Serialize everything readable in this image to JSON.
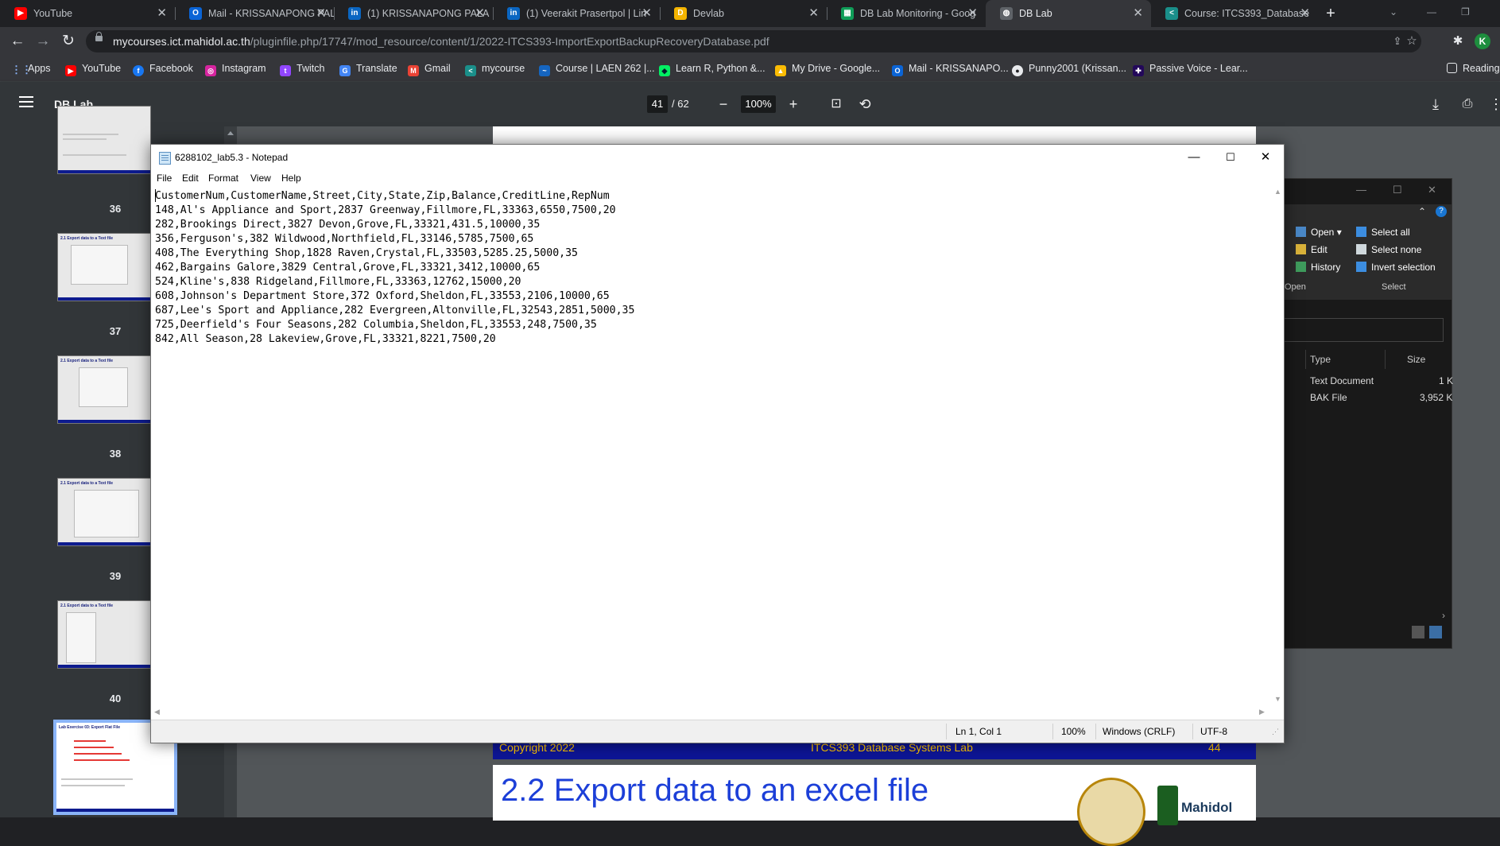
{
  "browser": {
    "tabs": [
      {
        "title": "YouTube",
        "icon": "youtube-icon",
        "color": "#ff0000",
        "glyph": "▶",
        "active": false
      },
      {
        "title": "Mail - KRISSANAPONG PALA",
        "icon": "outlook-icon",
        "color": "#0a64d6",
        "glyph": "O",
        "active": false
      },
      {
        "title": "(1) KRISSANAPONG PALA",
        "icon": "linkedin-icon",
        "color": "#0a66c2",
        "glyph": "in",
        "active": false
      },
      {
        "title": "(1) Veerakit Prasertpol | Lin",
        "icon": "linkedin-icon",
        "color": "#0a66c2",
        "glyph": "in",
        "active": false
      },
      {
        "title": "Devlab",
        "icon": "devlab-icon",
        "color": "#f4b400",
        "glyph": "D",
        "active": false
      },
      {
        "title": "DB Lab Monitoring - Goog",
        "icon": "sheets-icon",
        "color": "#0f9d58",
        "glyph": "▦",
        "active": false
      },
      {
        "title": "DB Lab",
        "icon": "globe-icon",
        "color": "#5f6368",
        "glyph": "◍",
        "active": true
      },
      {
        "title": "Course: ITCS393_Database",
        "icon": "mycourse-icon",
        "color": "#1a8f8a",
        "glyph": "<",
        "active": false
      }
    ],
    "new_tab": "+",
    "url_host": "mycourses.ict.mahidol.ac.th",
    "url_path": "/pluginfile.php/17747/mod_resource/content/1/2022-ITCS393-ImportExportBackupRecoveryDatabase.pdf",
    "profile_initial": "K",
    "bookmarks": [
      {
        "label": "Apps",
        "icon": "apps-grid-icon",
        "color": "#4285f4",
        "glyph": "⋮"
      },
      {
        "label": "YouTube",
        "icon": "youtube-icon",
        "color": "#ff0000",
        "glyph": "▶"
      },
      {
        "label": "Facebook",
        "icon": "facebook-icon",
        "color": "#1877f2",
        "glyph": "f"
      },
      {
        "label": "Instagram",
        "icon": "instagram-icon",
        "color": "#d6249f",
        "glyph": "◎"
      },
      {
        "label": "Twitch",
        "icon": "twitch-icon",
        "color": "#9146ff",
        "glyph": "t"
      },
      {
        "label": "Translate",
        "icon": "translate-icon",
        "color": "#4285f4",
        "glyph": "G"
      },
      {
        "label": "Gmail",
        "icon": "gmail-icon",
        "color": "#ea4335",
        "glyph": "M"
      },
      {
        "label": "mycourse",
        "icon": "mycourse-icon",
        "color": "#1a8f8a",
        "glyph": "<"
      },
      {
        "label": "Course | LAEN 262 |...",
        "icon": "course-icon",
        "color": "#1565c0",
        "glyph": "~"
      },
      {
        "label": "Learn R, Python &...",
        "icon": "datacamp-icon",
        "color": "#03ef62",
        "glyph": "◆"
      },
      {
        "label": "My Drive - Google...",
        "icon": "drive-icon",
        "color": "#fbbc04",
        "glyph": "▲"
      },
      {
        "label": "Mail - KRISSANAPO...",
        "icon": "outlook-icon",
        "color": "#0a64d6",
        "glyph": "O"
      },
      {
        "label": "Punny2001 (Krissan...",
        "icon": "github-icon",
        "color": "#444444",
        "glyph": "●"
      },
      {
        "label": "Passive Voice - Lear...",
        "icon": "british-council-icon",
        "color": "#23085a",
        "glyph": "✚"
      }
    ],
    "reading_list": "Reading"
  },
  "pdf": {
    "title": "DB Lab",
    "current_page": "41",
    "total_pages": "/  62",
    "zoom": "100%",
    "thumbnails": [
      {
        "label": "36",
        "heading": ""
      },
      {
        "label": "37",
        "heading": "2.1 Export data to a Text file"
      },
      {
        "label": "38",
        "heading": "2.1 Export data to a Text file"
      },
      {
        "label": "39",
        "heading": "2.1 Export data to a Text file"
      },
      {
        "label": "40",
        "heading": "2.1 Export data to a Text file"
      },
      {
        "label": "",
        "heading": "Lab Exercise 03: Export Flat File"
      }
    ],
    "page_footer_left": "Copyright 2022",
    "page_footer_mid": "ITCS393 Database Systems Lab",
    "page_footer_right": "44",
    "next_page_title": "2.2 Export data to an excel file",
    "logo_text": "Mahidol"
  },
  "explorer": {
    "ribbon": {
      "open": "Open ▾",
      "edit": "Edit",
      "history": "History",
      "select_all": "Select all",
      "select_none": "Select none",
      "invert_selection": "Invert selection",
      "group_open": "Open",
      "group_select": "Select"
    },
    "columns": {
      "type": "Type",
      "size": "Size"
    },
    "rows": [
      {
        "type": "Text Document",
        "size": "1 K"
      },
      {
        "type": "BAK File",
        "size": "3,952 K"
      }
    ]
  },
  "notepad": {
    "title": "6288102_lab5.3 - Notepad",
    "menu": [
      "File",
      "Edit",
      "Format",
      "View",
      "Help"
    ],
    "content": "CustomerNum,CustomerName,Street,City,State,Zip,Balance,CreditLine,RepNum\n148,Al's Appliance and Sport,2837 Greenway,Fillmore,FL,33363,6550,7500,20\n282,Brookings Direct,3827 Devon,Grove,FL,33321,431.5,10000,35\n356,Ferguson's,382 Wildwood,Northfield,FL,33146,5785,7500,65\n408,The Everything Shop,1828 Raven,Crystal,FL,33503,5285.25,5000,35\n462,Bargains Galore,3829 Central,Grove,FL,33321,3412,10000,65\n524,Kline's,838 Ridgeland,Fillmore,FL,33363,12762,15000,20\n608,Johnson's Department Store,372 Oxford,Sheldon,FL,33553,2106,10000,65\n687,Lee's Sport and Appliance,282 Evergreen,Altonville,FL,32543,2851,5000,35\n725,Deerfield's Four Seasons,282 Columbia,Sheldon,FL,33553,248,7500,35\n842,All Season,28 Lakeview,Grove,FL,33321,8221,7500,20",
    "status": {
      "position": "Ln 1, Col 1",
      "zoom": "100%",
      "line_ending": "Windows (CRLF)",
      "encoding": "UTF-8"
    }
  }
}
